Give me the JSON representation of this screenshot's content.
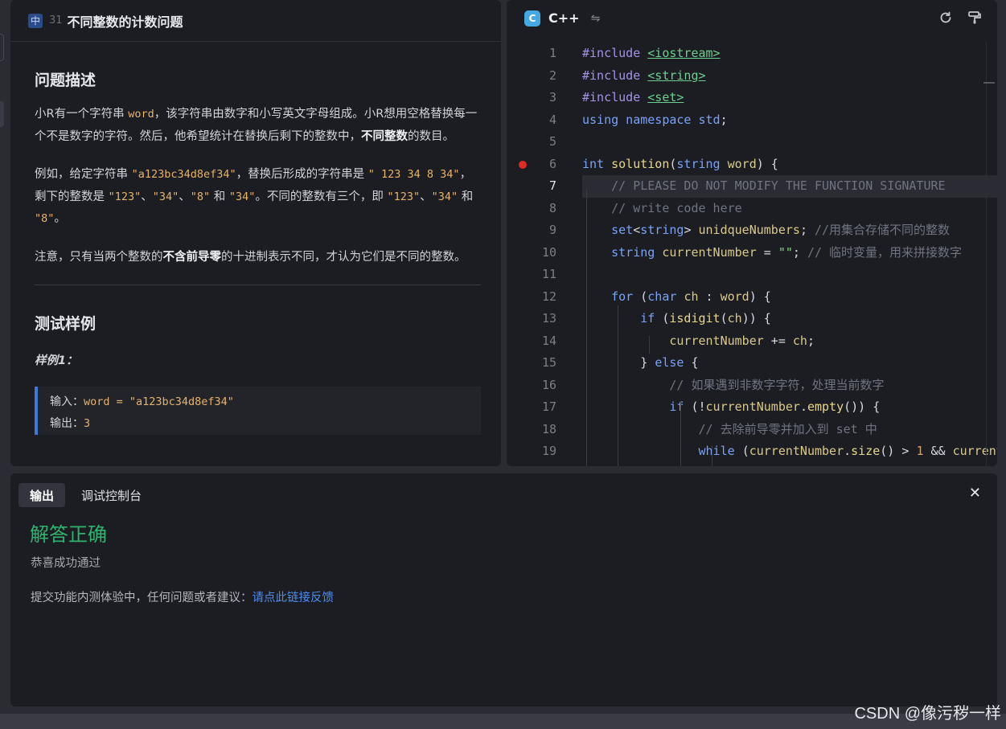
{
  "problem": {
    "difficulty_badge": "中",
    "number": "31",
    "title": "不同整数的计数问题",
    "description_heading": "问题描述",
    "p1_a": "小R有一个字符串 ",
    "p1_code": "word",
    "p1_b": "，该字符串由数字和小写英文字母组成。小R想用空格替换每一个不是数字的字符。然后，他希望统计在替换后剩下的整数中，",
    "p1_bold": "不同整数",
    "p1_c": "的数目。",
    "p2_a": "例如，给定字符串 ",
    "p2_code1": "\"a123bc34d8ef34\"",
    "p2_b": "，替换后形成的字符串是 ",
    "p2_code2": "\" 123 34 8 34\"",
    "p2_c": "，剩下的整数是 ",
    "p2_code3": "\"123\"",
    "p2_sep1": "、",
    "p2_code4": "\"34\"",
    "p2_sep2": "、",
    "p2_code5": "\"8\"",
    "p2_d": " 和 ",
    "p2_code6": "\"34\"",
    "p2_e": "。不同的整数有三个，即 ",
    "p2_code7": "\"123\"",
    "p2_sep3": "、",
    "p2_code8": "\"34\"",
    "p2_f": " 和 ",
    "p2_code9": "\"8\"",
    "p2_g": "。",
    "p3_a": "注意，只有当两个整数的",
    "p3_bold": "不含前导零",
    "p3_b": "的十进制表示不同，才认为它们是不同的整数。",
    "tests_heading": "测试样例",
    "example_label": "样例1：",
    "example_input_label": "输入：",
    "example_input_value": "word = \"a123bc34d8ef34\"",
    "example_output_label": "输出：",
    "example_output_value": "3"
  },
  "editor": {
    "language": "C++",
    "breakpoint_line": 6,
    "active_line": 7,
    "line_numbers": [
      "1",
      "2",
      "3",
      "4",
      "5",
      "6",
      "7",
      "8",
      "9",
      "10",
      "11",
      "12",
      "13",
      "14",
      "15",
      "16",
      "17",
      "18",
      "19"
    ],
    "lines": [
      {
        "tokens": [
          [
            "pp",
            "#include "
          ],
          [
            "inc",
            "<iostream>"
          ]
        ]
      },
      {
        "tokens": [
          [
            "pp",
            "#include "
          ],
          [
            "inc",
            "<string>"
          ]
        ]
      },
      {
        "tokens": [
          [
            "pp",
            "#include "
          ],
          [
            "inc",
            "<set>"
          ]
        ]
      },
      {
        "tokens": [
          [
            "kw",
            "using namespace "
          ],
          [
            "ty",
            "std"
          ],
          [
            "",
            "; "
          ]
        ]
      },
      {
        "tokens": [
          [
            "",
            ""
          ]
        ]
      },
      {
        "tokens": [
          [
            "ty",
            "int "
          ],
          [
            "fn",
            "solution"
          ],
          [
            "",
            "("
          ],
          [
            "ty",
            "string "
          ],
          [
            "var",
            "word"
          ],
          [
            "",
            ") {"
          ]
        ]
      },
      {
        "tokens": [
          [
            "",
            "    "
          ],
          [
            "cm",
            "// PLEASE DO NOT MODIFY THE FUNCTION SIGNATURE"
          ]
        ]
      },
      {
        "tokens": [
          [
            "",
            "    "
          ],
          [
            "cm",
            "// write code here"
          ]
        ]
      },
      {
        "tokens": [
          [
            "",
            "    "
          ],
          [
            "ty",
            "set"
          ],
          [
            "",
            "<"
          ],
          [
            "ty",
            "string"
          ],
          [
            "",
            "> "
          ],
          [
            "var",
            "unidqueNumbers"
          ],
          [
            "",
            "; "
          ],
          [
            "cm",
            "//用集合存储不同的整数"
          ]
        ]
      },
      {
        "tokens": [
          [
            "",
            "    "
          ],
          [
            "ty",
            "string "
          ],
          [
            "var",
            "currentNumber"
          ],
          [
            "",
            " = "
          ],
          [
            "st",
            "\"\""
          ],
          [
            "",
            "; "
          ],
          [
            "cm",
            "// 临时变量，用来拼接数字"
          ]
        ]
      },
      {
        "tokens": [
          [
            "",
            ""
          ]
        ]
      },
      {
        "tokens": [
          [
            "",
            "    "
          ],
          [
            "kw",
            "for "
          ],
          [
            "",
            "("
          ],
          [
            "ty",
            "char "
          ],
          [
            "var",
            "ch"
          ],
          [
            "",
            " : "
          ],
          [
            "var",
            "word"
          ],
          [
            "",
            ") {"
          ]
        ]
      },
      {
        "tokens": [
          [
            "",
            "        "
          ],
          [
            "kw",
            "if "
          ],
          [
            "",
            "("
          ],
          [
            "fn",
            "isdigit"
          ],
          [
            "",
            "("
          ],
          [
            "var",
            "ch"
          ],
          [
            "",
            ")) {"
          ]
        ]
      },
      {
        "tokens": [
          [
            "",
            "            "
          ],
          [
            "var",
            "currentNumber"
          ],
          [
            "",
            " += "
          ],
          [
            "var",
            "ch"
          ],
          [
            "",
            ";"
          ]
        ]
      },
      {
        "tokens": [
          [
            "",
            "        } "
          ],
          [
            "kw",
            "else "
          ],
          [
            "",
            "{"
          ]
        ]
      },
      {
        "tokens": [
          [
            "",
            "            "
          ],
          [
            "cm",
            "// 如果遇到非数字字符，处理当前数字"
          ]
        ]
      },
      {
        "tokens": [
          [
            "",
            "            "
          ],
          [
            "kw",
            "if "
          ],
          [
            "",
            "(!"
          ],
          [
            "var",
            "currentNumber"
          ],
          [
            "",
            "."
          ],
          [
            "fn",
            "empty"
          ],
          [
            "",
            "()) {"
          ]
        ]
      },
      {
        "tokens": [
          [
            "",
            "                "
          ],
          [
            "cm",
            "// 去除前导零并加入到 set 中"
          ]
        ]
      },
      {
        "tokens": [
          [
            "",
            "                "
          ],
          [
            "kw",
            "while "
          ],
          [
            "",
            "("
          ],
          [
            "var",
            "currentNumber"
          ],
          [
            "",
            "."
          ],
          [
            "fn",
            "size"
          ],
          [
            "",
            "() > "
          ],
          [
            "nu",
            "1"
          ],
          [
            "",
            " && "
          ],
          [
            "var",
            "currentNumber"
          ]
        ]
      }
    ]
  },
  "output": {
    "tab_output": "输出",
    "tab_console": "调试控制台",
    "result_title": "解答正确",
    "result_subtitle": "恭喜成功通过",
    "feedback_text": "提交功能内测体验中，任何问题或者建议：",
    "feedback_link": "请点此链接反馈"
  },
  "watermark": "CSDN @像污秽一样",
  "colors": {
    "success": "#2fb46f",
    "link": "#4d8cf0",
    "breakpoint": "#e02b24"
  }
}
